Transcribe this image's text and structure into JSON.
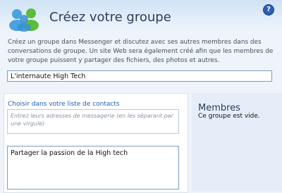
{
  "header": {
    "title": "Créez votre groupe",
    "logo_icon": "messenger-buddies-icon",
    "help_label": "?",
    "help_icon": "help-icon",
    "accent": "#2c5fb4"
  },
  "intro": {
    "text": "Créez un groupe dans Messenger et discutez avec ses autres membres dans des conversations de groupe. Un site Web sera également créé afin que les membres de votre groupe puissent y partager des fichiers, des photos et autres."
  },
  "group_name": {
    "value": "L'internaute High Tech"
  },
  "contacts": {
    "link_label": "Choisir dans votre liste de contacts",
    "email_placeholder": "Entrez leurs adresses de messagerie (en les séparant par une virgule)"
  },
  "message": {
    "value": "Partager la passion de la High tech"
  },
  "members": {
    "title": "Membres",
    "empty_text": "Ce groupe est vide."
  }
}
